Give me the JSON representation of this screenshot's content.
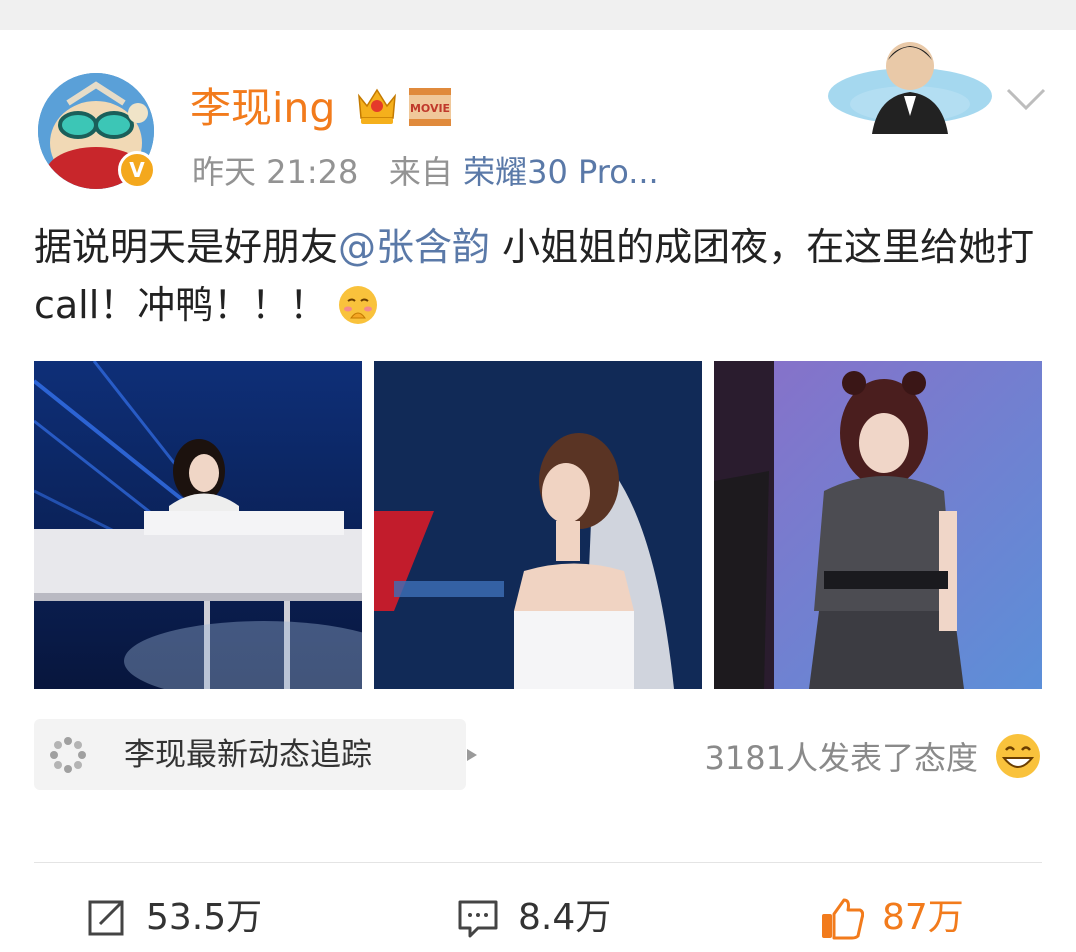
{
  "post": {
    "username": "李现ing",
    "time": "昨天 21:28",
    "from_label": "来自",
    "device": "荣耀30 Pro...",
    "verified_badge": "V",
    "movie_badge": "MOVIE",
    "content": {
      "part1": "据说明天是好朋友",
      "mention": "@张含韵",
      "part2": " 小姐姐的成团夜，在这里给她打call！冲鸭！！！"
    },
    "images": [
      {
        "icon": "photo-piano-performance"
      },
      {
        "icon": "photo-wedding-veil"
      },
      {
        "icon": "photo-stage-dance"
      }
    ]
  },
  "topic_tracker": {
    "label": "李现最新动态追踪"
  },
  "reactions": {
    "text": "3181人发表了态度"
  },
  "actions": {
    "repost": {
      "count": "53.5万"
    },
    "comment": {
      "count": "8.4万"
    },
    "like": {
      "count": "87万"
    }
  },
  "colors": {
    "accent": "#f27b1c",
    "link": "#5a79a8",
    "muted": "#939393",
    "like": "#f27b1c"
  }
}
